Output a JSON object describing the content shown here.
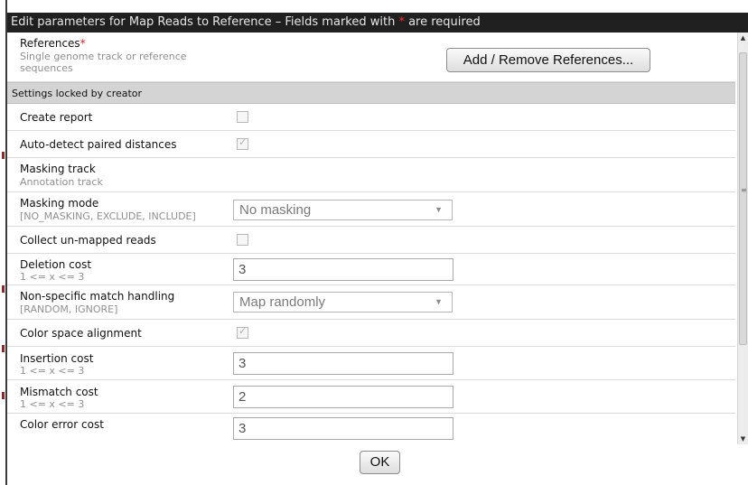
{
  "dialog": {
    "title_prefix": "Edit parameters for Map Reads to Reference – Fields marked with ",
    "title_star": "*",
    "title_suffix": " are required",
    "ok_label": "OK"
  },
  "references": {
    "label": "References",
    "required_star": "*",
    "sub": "Single genome track or reference sequences",
    "button_label": "Add / Remove References..."
  },
  "section": {
    "label": "Settings locked by creator"
  },
  "params": {
    "create_report": {
      "label": "Create report",
      "checked": false
    },
    "auto_detect": {
      "label": "Auto-detect paired distances",
      "checked": true
    },
    "masking_track": {
      "label": "Masking track",
      "sub": "Annotation track"
    },
    "masking_mode": {
      "label": "Masking mode",
      "sub": "[NO_MASKING, EXCLUDE, INCLUDE]",
      "value": "No masking"
    },
    "collect_unmapped": {
      "label": "Collect un-mapped reads",
      "checked": false
    },
    "deletion_cost": {
      "label": "Deletion cost",
      "sub": "1 <= x <= 3",
      "value": "3"
    },
    "nonspecific": {
      "label": "Non-specific match handling",
      "sub": "[RANDOM, IGNORE]",
      "value": "Map randomly"
    },
    "color_space": {
      "label": "Color space alignment",
      "checked": true
    },
    "insertion_cost": {
      "label": "Insertion cost",
      "sub": "1 <= x <= 3",
      "value": "3"
    },
    "mismatch_cost": {
      "label": "Mismatch cost",
      "sub": "1 <= x <= 3",
      "value": "2"
    },
    "color_error_cost": {
      "label": "Color error cost",
      "value": "3"
    }
  },
  "icons": {
    "dropdown": "chevron-down-icon",
    "scroll_up": "scroll-up-arrow-icon",
    "scroll_down": "scroll-down-arrow-icon",
    "check": "checkmark-icon"
  }
}
